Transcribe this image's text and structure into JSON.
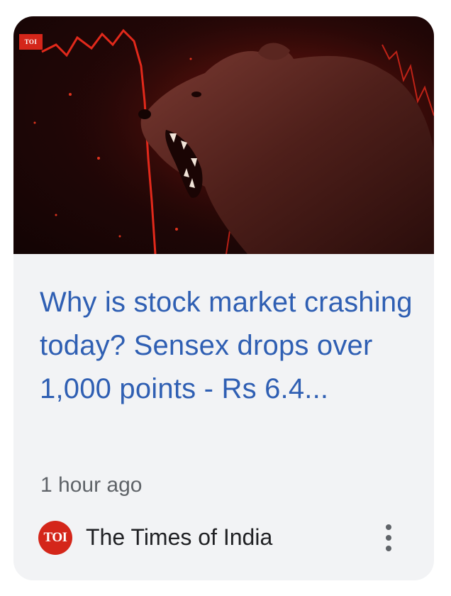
{
  "article": {
    "image_alt": "Snarling bear over red falling stock chart",
    "image_badge": "TOI",
    "headline": "Why is stock market crashing today? Sensex drops over 1,000 points - Rs 6.4...",
    "time_ago": "1 hour ago",
    "source": {
      "logo_text": "TOI",
      "name": "The Times of India"
    },
    "more_icon": "more-vert-icon"
  },
  "colors": {
    "headline": "#2f5fb3",
    "card_bg": "#f2f3f5",
    "source_brand": "#d4261a",
    "muted_text": "#5f6368"
  }
}
